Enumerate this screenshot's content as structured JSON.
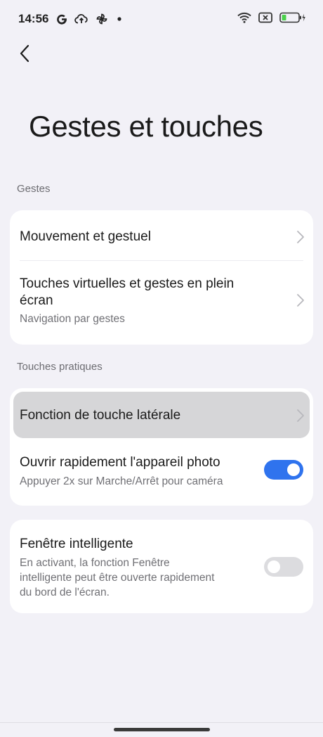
{
  "status_bar": {
    "time": "14:56",
    "left_icons": [
      "google-icon",
      "cloud-upload-icon",
      "pinwheel-icon",
      "dot-icon"
    ],
    "right_icons": [
      "wifi-icon",
      "sim-no-signal-icon",
      "battery-charging-icon"
    ]
  },
  "header": {
    "title": "Gestes et touches"
  },
  "sections": {
    "gestures": {
      "label": "Gestes",
      "items": [
        {
          "title": "Mouvement et gestuel"
        },
        {
          "title_line1": "Touches virtuelles et gestes en plein",
          "title_line2": "écran",
          "subtitle": "Navigation par gestes"
        }
      ]
    },
    "practical_keys": {
      "label": "Touches pratiques",
      "items": [
        {
          "title": "Fonction de touche latérale"
        },
        {
          "title": "Ouvrir rapidement l'appareil photo",
          "subtitle": "Appuyer 2x sur Marche/Arrêt pour caméra",
          "enabled": true
        }
      ]
    },
    "smart_window": {
      "title": "Fenêtre intelligente",
      "desc_line1": "En activant, la fonction Fenêtre",
      "desc_line2": "intelligente peut être ouverte rapidement",
      "desc_line3": "du bord de l'écran.",
      "enabled": false
    }
  },
  "colors": {
    "background": "#f2f1f7",
    "accent": "#2f73ee",
    "toggle_off": "#dcdcdf"
  }
}
